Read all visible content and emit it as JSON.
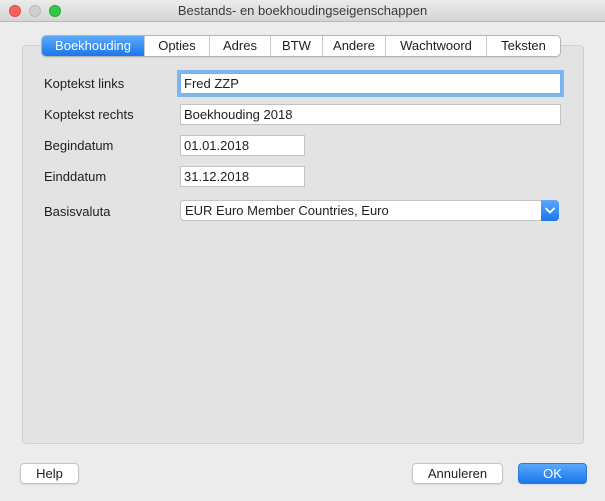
{
  "window": {
    "title": "Bestands- en boekhoudingseigenschappen"
  },
  "tabs": [
    {
      "label": "Boekhouding",
      "active": true
    },
    {
      "label": "Opties",
      "active": false
    },
    {
      "label": "Adres",
      "active": false
    },
    {
      "label": "BTW",
      "active": false
    },
    {
      "label": "Andere",
      "active": false
    },
    {
      "label": "Wachtwoord",
      "active": false
    },
    {
      "label": "Teksten",
      "active": false
    }
  ],
  "form": {
    "koptekst_links": {
      "label": "Koptekst links",
      "value": "Fred ZZP"
    },
    "koptekst_rechts": {
      "label": "Koptekst rechts",
      "value": "Boekhouding 2018"
    },
    "begindatum": {
      "label": "Begindatum",
      "value": "01.01.2018"
    },
    "einddatum": {
      "label": "Einddatum",
      "value": "31.12.2018"
    },
    "basisvaluta": {
      "label": "Basisvaluta",
      "value": "EUR Euro Member Countries, Euro"
    }
  },
  "buttons": {
    "help": "Help",
    "cancel": "Annuleren",
    "ok": "OK"
  },
  "colors": {
    "accent": "#1a76e9",
    "close": "#fc605c",
    "maximize": "#34c84a"
  }
}
